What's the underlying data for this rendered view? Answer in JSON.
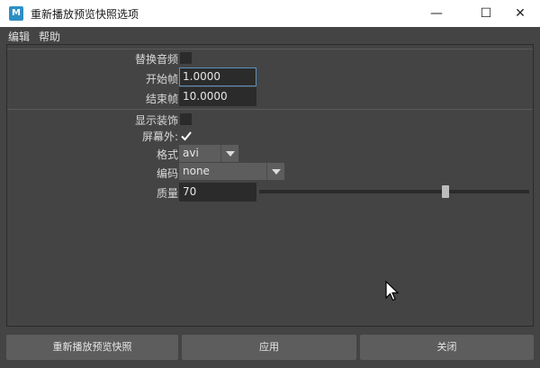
{
  "window": {
    "title": "重新播放预览快照选项",
    "icon_letter": "M",
    "controls": {
      "minimize": "—",
      "maximize": "☐",
      "close": "✕"
    }
  },
  "menu": {
    "items": [
      "编辑",
      "帮助"
    ]
  },
  "form": {
    "replace_audio": {
      "label": "替换音频",
      "checked": false
    },
    "start_frame": {
      "label": "开始帧",
      "value": "1.0000"
    },
    "end_frame": {
      "label": "结束帧",
      "value": "10.0000"
    },
    "show_ornaments": {
      "label": "显示装饰",
      "checked": false
    },
    "offscreen": {
      "label": "屏幕外:",
      "checked": true
    },
    "format": {
      "label": "格式",
      "selected": "avi"
    },
    "encoding": {
      "label": "编码",
      "selected": "none"
    },
    "quality": {
      "label": "质量",
      "value": "70",
      "slider_fraction": 0.69
    }
  },
  "buttons": {
    "replay": "重新播放预览快照",
    "apply": "应用",
    "close": "关闭"
  },
  "colors": {
    "background": "#444444",
    "field": "#2b2b2b",
    "button": "#5d5d5d",
    "focus": "#5d8fbf"
  }
}
